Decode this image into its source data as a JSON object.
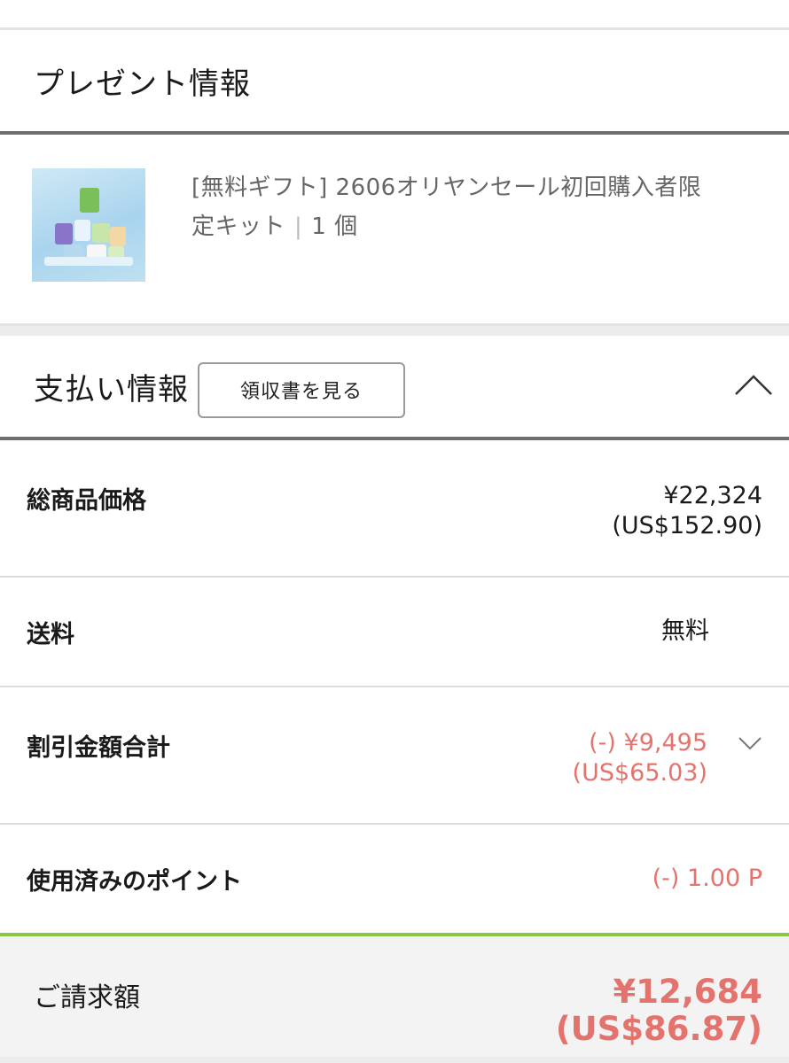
{
  "present": {
    "title": "プレゼント情報",
    "gift_name": "[無料ギフト] 2606オリヤンセール初回購入者限定キット",
    "quantity": "1 個"
  },
  "payment": {
    "title": "支払い情報",
    "receipt_button": "領収書を見る",
    "total_label": "総商品価格",
    "total_jpy": "¥22,324",
    "total_usd": "(US$152.90)",
    "shipping_label": "送料",
    "shipping_value": "無料",
    "discount_label": "割引金額合計",
    "discount_jpy": "(-) ¥9,495",
    "discount_usd": "(US$65.03)",
    "points_label": "使用済みのポイント",
    "points_value": "(-) 1.00 P",
    "billing_label": "ご請求額",
    "billing_jpy": "¥12,684",
    "billing_usd": "(US$86.87)"
  },
  "colors": {
    "accent_red": "#e4736d",
    "accent_green": "#8ec63f"
  }
}
